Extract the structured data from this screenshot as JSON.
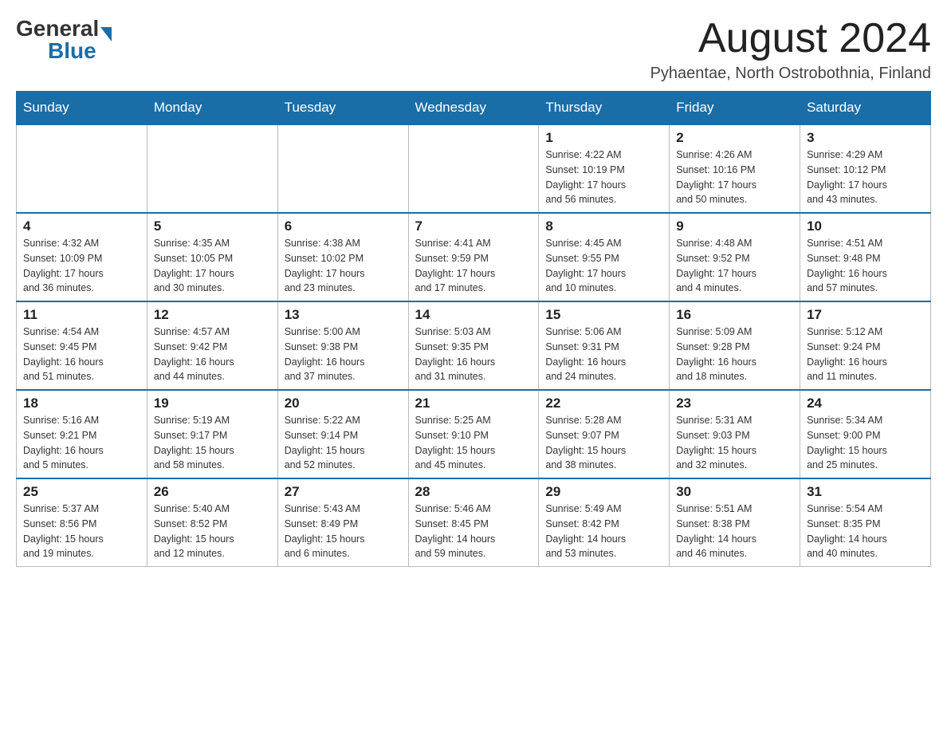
{
  "header": {
    "logo_general": "General",
    "logo_blue": "Blue",
    "month_title": "August 2024",
    "location": "Pyhaentae, North Ostrobothnia, Finland"
  },
  "weekdays": [
    "Sunday",
    "Monday",
    "Tuesday",
    "Wednesday",
    "Thursday",
    "Friday",
    "Saturday"
  ],
  "weeks": [
    [
      {
        "day": "",
        "info": ""
      },
      {
        "day": "",
        "info": ""
      },
      {
        "day": "",
        "info": ""
      },
      {
        "day": "",
        "info": ""
      },
      {
        "day": "1",
        "info": "Sunrise: 4:22 AM\nSunset: 10:19 PM\nDaylight: 17 hours\nand 56 minutes."
      },
      {
        "day": "2",
        "info": "Sunrise: 4:26 AM\nSunset: 10:16 PM\nDaylight: 17 hours\nand 50 minutes."
      },
      {
        "day": "3",
        "info": "Sunrise: 4:29 AM\nSunset: 10:12 PM\nDaylight: 17 hours\nand 43 minutes."
      }
    ],
    [
      {
        "day": "4",
        "info": "Sunrise: 4:32 AM\nSunset: 10:09 PM\nDaylight: 17 hours\nand 36 minutes."
      },
      {
        "day": "5",
        "info": "Sunrise: 4:35 AM\nSunset: 10:05 PM\nDaylight: 17 hours\nand 30 minutes."
      },
      {
        "day": "6",
        "info": "Sunrise: 4:38 AM\nSunset: 10:02 PM\nDaylight: 17 hours\nand 23 minutes."
      },
      {
        "day": "7",
        "info": "Sunrise: 4:41 AM\nSunset: 9:59 PM\nDaylight: 17 hours\nand 17 minutes."
      },
      {
        "day": "8",
        "info": "Sunrise: 4:45 AM\nSunset: 9:55 PM\nDaylight: 17 hours\nand 10 minutes."
      },
      {
        "day": "9",
        "info": "Sunrise: 4:48 AM\nSunset: 9:52 PM\nDaylight: 17 hours\nand 4 minutes."
      },
      {
        "day": "10",
        "info": "Sunrise: 4:51 AM\nSunset: 9:48 PM\nDaylight: 16 hours\nand 57 minutes."
      }
    ],
    [
      {
        "day": "11",
        "info": "Sunrise: 4:54 AM\nSunset: 9:45 PM\nDaylight: 16 hours\nand 51 minutes."
      },
      {
        "day": "12",
        "info": "Sunrise: 4:57 AM\nSunset: 9:42 PM\nDaylight: 16 hours\nand 44 minutes."
      },
      {
        "day": "13",
        "info": "Sunrise: 5:00 AM\nSunset: 9:38 PM\nDaylight: 16 hours\nand 37 minutes."
      },
      {
        "day": "14",
        "info": "Sunrise: 5:03 AM\nSunset: 9:35 PM\nDaylight: 16 hours\nand 31 minutes."
      },
      {
        "day": "15",
        "info": "Sunrise: 5:06 AM\nSunset: 9:31 PM\nDaylight: 16 hours\nand 24 minutes."
      },
      {
        "day": "16",
        "info": "Sunrise: 5:09 AM\nSunset: 9:28 PM\nDaylight: 16 hours\nand 18 minutes."
      },
      {
        "day": "17",
        "info": "Sunrise: 5:12 AM\nSunset: 9:24 PM\nDaylight: 16 hours\nand 11 minutes."
      }
    ],
    [
      {
        "day": "18",
        "info": "Sunrise: 5:16 AM\nSunset: 9:21 PM\nDaylight: 16 hours\nand 5 minutes."
      },
      {
        "day": "19",
        "info": "Sunrise: 5:19 AM\nSunset: 9:17 PM\nDaylight: 15 hours\nand 58 minutes."
      },
      {
        "day": "20",
        "info": "Sunrise: 5:22 AM\nSunset: 9:14 PM\nDaylight: 15 hours\nand 52 minutes."
      },
      {
        "day": "21",
        "info": "Sunrise: 5:25 AM\nSunset: 9:10 PM\nDaylight: 15 hours\nand 45 minutes."
      },
      {
        "day": "22",
        "info": "Sunrise: 5:28 AM\nSunset: 9:07 PM\nDaylight: 15 hours\nand 38 minutes."
      },
      {
        "day": "23",
        "info": "Sunrise: 5:31 AM\nSunset: 9:03 PM\nDaylight: 15 hours\nand 32 minutes."
      },
      {
        "day": "24",
        "info": "Sunrise: 5:34 AM\nSunset: 9:00 PM\nDaylight: 15 hours\nand 25 minutes."
      }
    ],
    [
      {
        "day": "25",
        "info": "Sunrise: 5:37 AM\nSunset: 8:56 PM\nDaylight: 15 hours\nand 19 minutes."
      },
      {
        "day": "26",
        "info": "Sunrise: 5:40 AM\nSunset: 8:52 PM\nDaylight: 15 hours\nand 12 minutes."
      },
      {
        "day": "27",
        "info": "Sunrise: 5:43 AM\nSunset: 8:49 PM\nDaylight: 15 hours\nand 6 minutes."
      },
      {
        "day": "28",
        "info": "Sunrise: 5:46 AM\nSunset: 8:45 PM\nDaylight: 14 hours\nand 59 minutes."
      },
      {
        "day": "29",
        "info": "Sunrise: 5:49 AM\nSunset: 8:42 PM\nDaylight: 14 hours\nand 53 minutes."
      },
      {
        "day": "30",
        "info": "Sunrise: 5:51 AM\nSunset: 8:38 PM\nDaylight: 14 hours\nand 46 minutes."
      },
      {
        "day": "31",
        "info": "Sunrise: 5:54 AM\nSunset: 8:35 PM\nDaylight: 14 hours\nand 40 minutes."
      }
    ]
  ]
}
